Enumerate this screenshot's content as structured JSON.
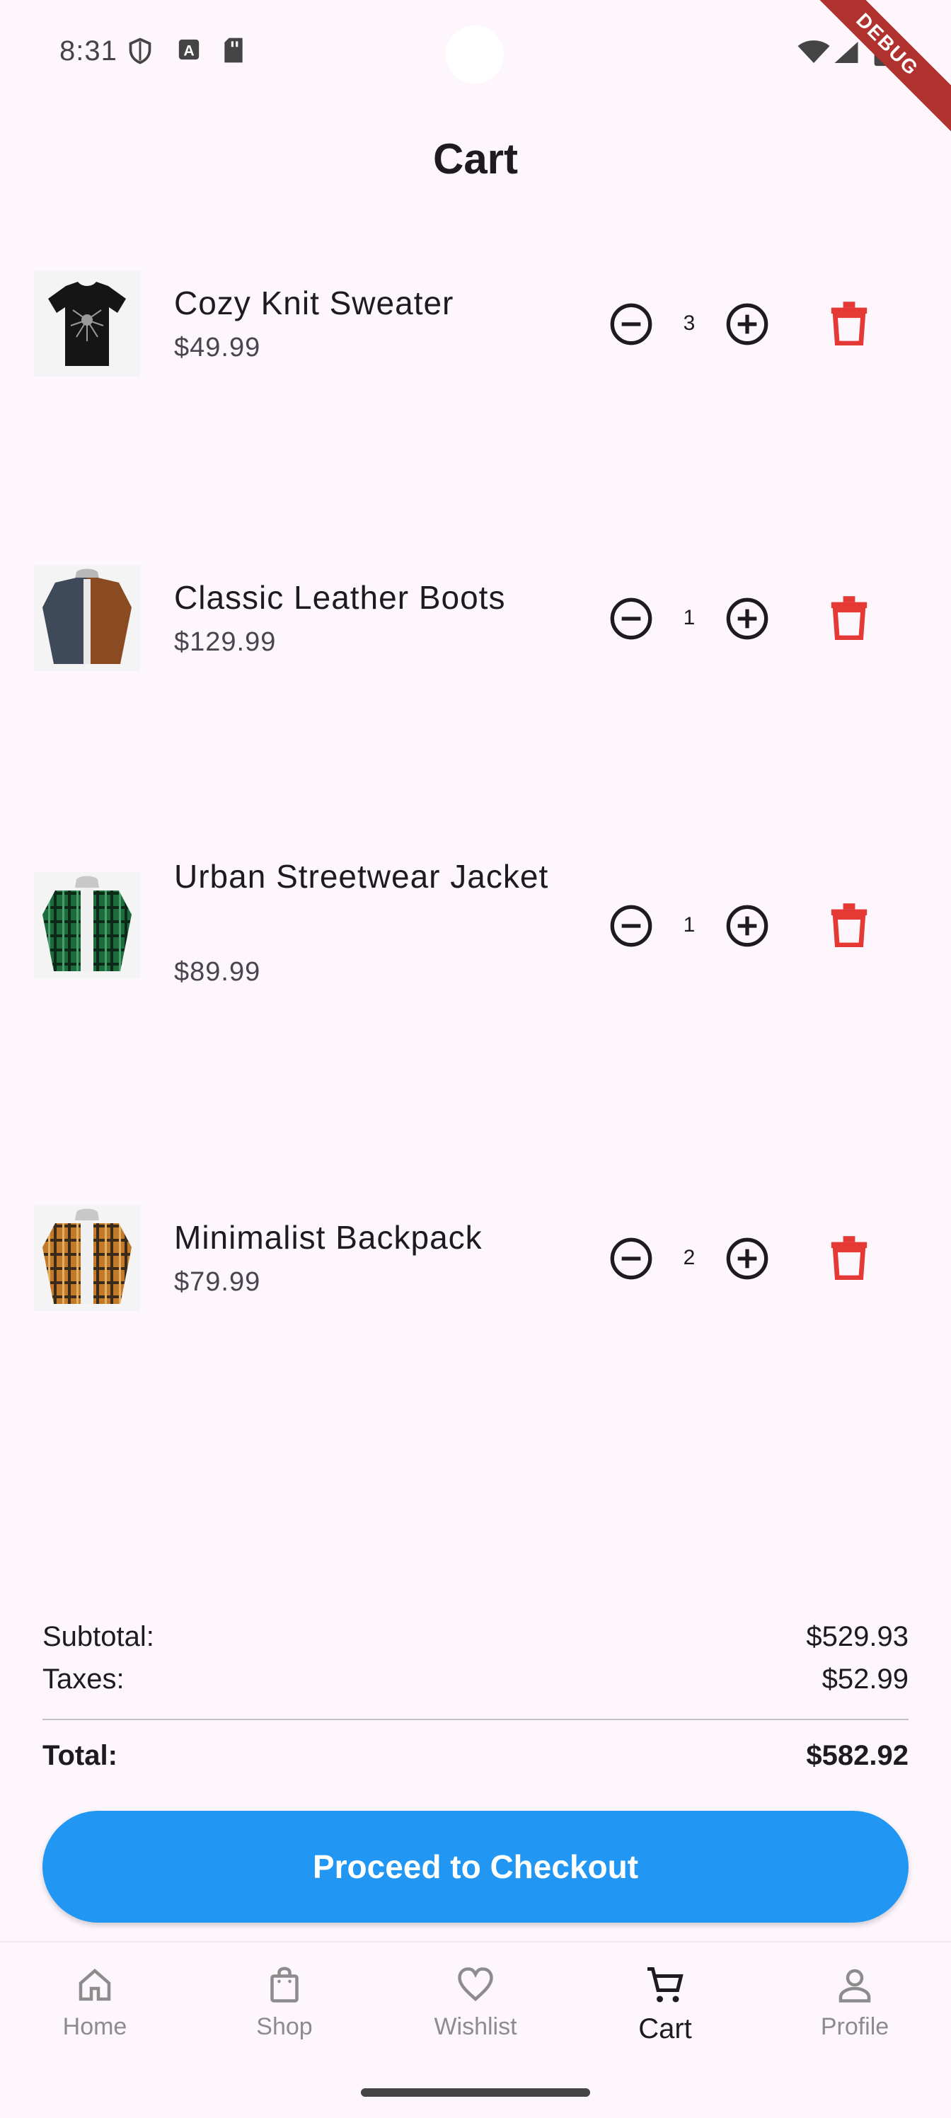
{
  "status_bar": {
    "time": "8:31",
    "icons": [
      "shield-icon",
      "text-a-icon",
      "sd-card-icon",
      "wifi-icon",
      "signal-icon",
      "battery-icon"
    ],
    "debug_label": "DEBUG"
  },
  "header": {
    "title": "Cart"
  },
  "cart_items": [
    {
      "name": "Cozy Knit Sweater",
      "price": "$49.99",
      "quantity": "3",
      "image": "black-tshirt"
    },
    {
      "name": "Classic Leather Boots",
      "price": "$129.99",
      "quantity": "1",
      "image": "navy-brown-hoodie-jacket"
    },
    {
      "name": "Urban Streetwear Jacket",
      "price": "$89.99",
      "quantity": "1",
      "image": "green-plaid-hoodie"
    },
    {
      "name": "Minimalist Backpack",
      "price": "$79.99",
      "quantity": "2",
      "image": "orange-plaid-hoodie"
    }
  ],
  "summary": {
    "subtotal_label": "Subtotal:",
    "subtotal_value": "$529.93",
    "taxes_label": "Taxes:",
    "taxes_value": "$52.99",
    "total_label": "Total:",
    "total_value": "$582.92"
  },
  "checkout_button": {
    "label": "Proceed to Checkout"
  },
  "bottom_nav": {
    "items": [
      {
        "label": "Home",
        "icon": "home-icon",
        "active": false
      },
      {
        "label": "Shop",
        "icon": "shopping-bag-icon",
        "active": false
      },
      {
        "label": "Wishlist",
        "icon": "heart-icon",
        "active": false
      },
      {
        "label": "Cart",
        "icon": "cart-icon",
        "active": true
      },
      {
        "label": "Profile",
        "icon": "person-icon",
        "active": false
      }
    ]
  },
  "colors": {
    "background": "#fdf7fd",
    "accent": "#2196f3",
    "delete": "#e53935",
    "text": "#1d1b20",
    "inactive_nav": "#8c8c8c"
  }
}
